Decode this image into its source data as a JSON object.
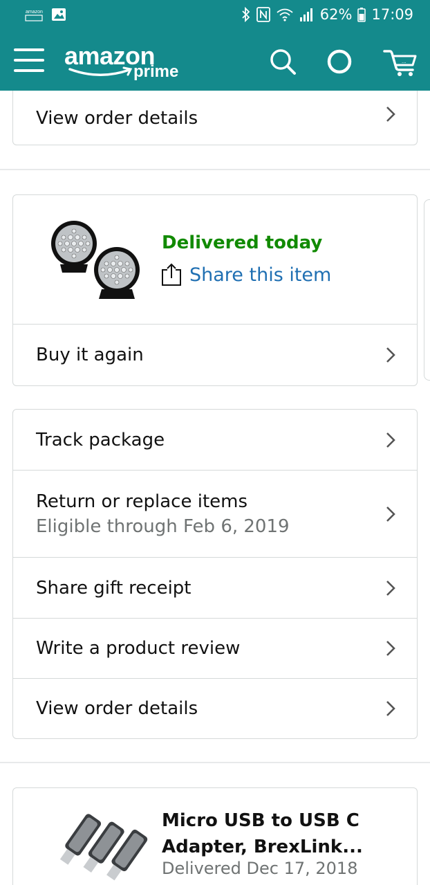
{
  "status_bar": {
    "battery": "62%",
    "time": "17:09",
    "icons": [
      "amazon-notification-icon",
      "image-notification-icon",
      "bluetooth-icon",
      "nfc-icon",
      "wifi-icon",
      "signal-icon",
      "battery-icon"
    ]
  },
  "header": {
    "logo_word": "amazon",
    "logo_prime": "prime",
    "bg_color": "#148a8c",
    "icons": [
      "menu-icon",
      "search-icon",
      "alexa-icon",
      "cart-icon"
    ]
  },
  "top_card": {
    "row_label": "View order details"
  },
  "order_card": {
    "status": "Delivered today",
    "share_label": "Share this item",
    "buy_again_label": "Buy it again",
    "status_color": "#118a00",
    "link_color": "#1f6fb2"
  },
  "actions_card": {
    "rows": [
      {
        "label": "Track package"
      },
      {
        "label": "Return or replace items",
        "sub": "Eligible through Feb 6, 2019"
      },
      {
        "label": "Share gift receipt"
      },
      {
        "label": "Write a product review"
      },
      {
        "label": "View order details"
      }
    ]
  },
  "next_item": {
    "title_line1": "Micro USB to USB C",
    "title_line2": "Adapter, BrexLink...",
    "status": "Delivered Dec 17, 2018"
  }
}
